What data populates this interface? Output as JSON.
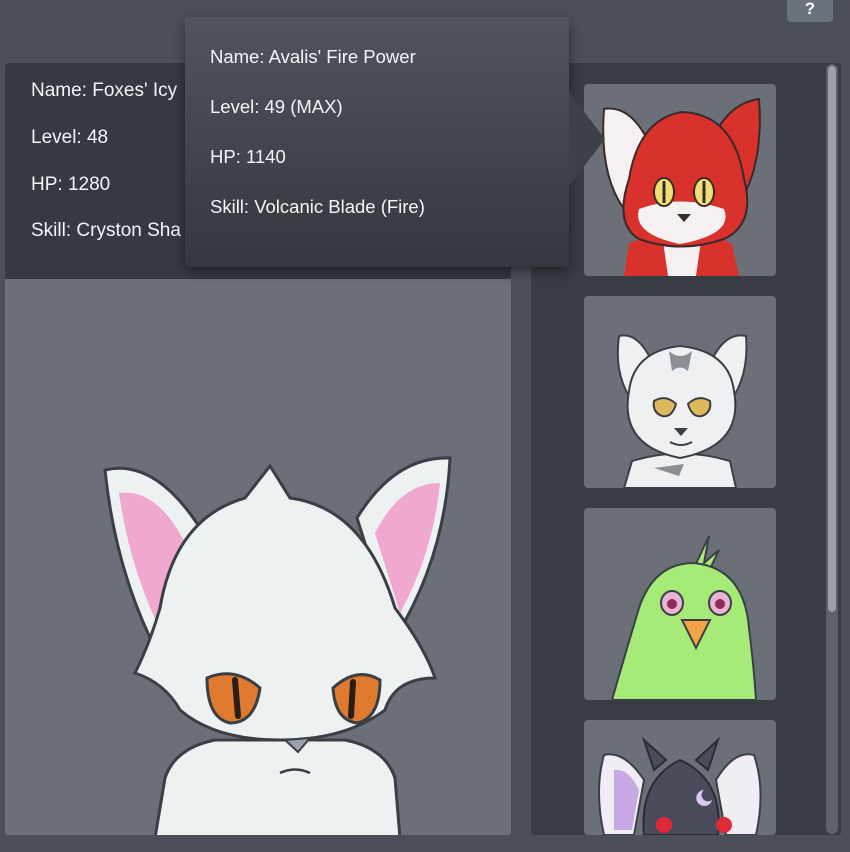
{
  "help": {
    "label": "?"
  },
  "selected": {
    "name": "Name: Foxes' Icy",
    "level": "Level: 48",
    "hp": "HP: 1280",
    "skill": "Skill: Cryston Sha"
  },
  "tooltip": {
    "name": "Name: Avalis' Fire Power",
    "level": "Level: 49 (MAX)",
    "hp": "HP: 1140",
    "skill": "Skill: Volcanic Blade (Fire)"
  },
  "roster": [
    {
      "icon": "red-fox-portrait-icon",
      "color": "#d9312b"
    },
    {
      "icon": "white-tiger-cat-portrait-icon",
      "color": "#eef0f1"
    },
    {
      "icon": "green-bird-portrait-icon",
      "color": "#a6ea78"
    },
    {
      "icon": "dark-horned-creature-portrait-icon",
      "color": "#4a4c5c"
    }
  ],
  "colors": {
    "background": "#4b5058",
    "panel": "#6b7078",
    "stats_box": "#353941",
    "tooltip": "#42464d"
  }
}
